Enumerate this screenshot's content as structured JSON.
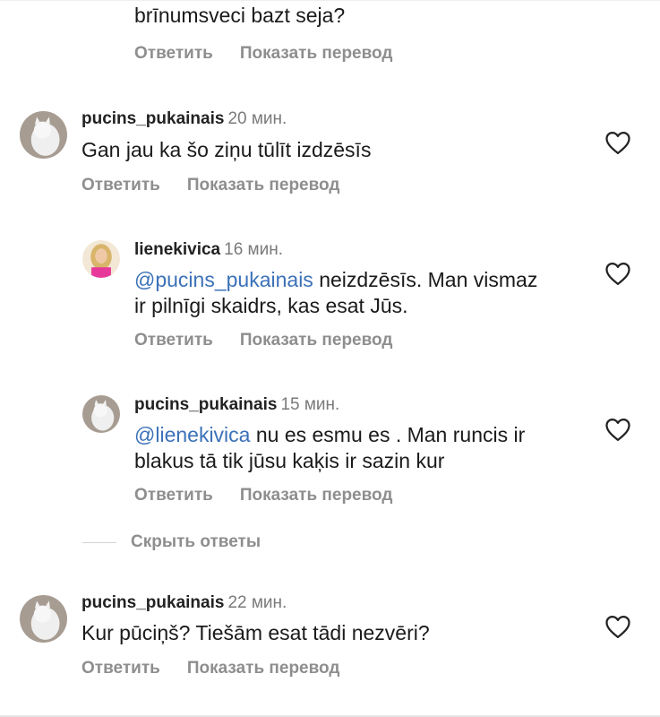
{
  "top_fragment": {
    "text": "brīnumsveci bazt seja?"
  },
  "action_labels": {
    "reply": "Ответить",
    "translate": "Показать перевод"
  },
  "comments": [
    {
      "username": "pucins_pukainais",
      "time": "20 мин.",
      "lines": [
        "Gan jau ka šo ziņu tūlīt izdzēsīs"
      ]
    },
    {
      "username": "lienekivica",
      "time": "16 мин.",
      "mention": "@pucins_pukainais",
      "lines": [
        " neizdzēsīs. Man vismaz",
        "ir pilnīgi skaidrs, kas esat Jūs."
      ]
    },
    {
      "username": "pucins_pukainais",
      "time": "15 мин.",
      "mention": "@lienekivica",
      "lines": [
        " nu es esmu es . Man runcis ir",
        "blakus tā tik jūsu kaķis ir sazin kur"
      ]
    },
    {
      "username": "pucins_pukainais",
      "time": "22 мин.",
      "lines": [
        "Kur pūciņš? Tiešām esat tādi nezvēri?"
      ]
    }
  ],
  "hide_replies": "Скрыть ответы",
  "icons": {
    "like": "heart-outline-icon",
    "avatar_cat": "cat-avatar",
    "avatar_person": "person-avatar"
  },
  "colors": {
    "mention": "#3b71b8",
    "secondary": "#8e8e8e",
    "text": "#1a1a1a"
  }
}
